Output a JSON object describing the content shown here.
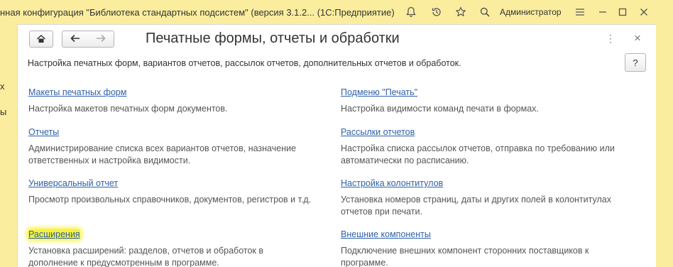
{
  "app": {
    "title": "нная конфигурация \"Библиотека стандартных подсистем\" (версия 3.1.2...   (1С:Предприятие)",
    "user": "Администратор"
  },
  "left_strip": {
    "fragments": [
      "х",
      "ы"
    ]
  },
  "page": {
    "title": "Печатные формы, отчеты и обработки",
    "subtitle": "Настройка печатных форм, вариантов отчетов, рассылок отчетов, дополнительных отчетов и обработок.",
    "help_label": "?",
    "more_label": "⋮",
    "close_label": "×"
  },
  "items_left": [
    {
      "label": "Макеты печатных форм",
      "desc": "Настройка макетов печатных форм документов."
    },
    {
      "label": "Отчеты",
      "desc": "Администрирование списка всех вариантов отчетов, назначение ответственных и настройка видимости."
    },
    {
      "label": "Универсальный отчет",
      "desc": "Просмотр произвольных справочников, документов, регистров и т.д."
    },
    {
      "label": "Расширения",
      "desc": "Установка расширений: разделов, отчетов и обработок в дополнение к предусмотренным в программе."
    }
  ],
  "items_right": [
    {
      "label": "Подменю \"Печать\"",
      "desc": "Настройка видимости команд печати в формах."
    },
    {
      "label": "Рассылки отчетов",
      "desc": "Настройка списка рассылок отчетов, отправка по требованию или автоматически по расписанию."
    },
    {
      "label": "Настройка колонтитулов",
      "desc": "Установка номеров страниц, даты и других полей в колонтитулах отчетов при печати."
    },
    {
      "label": "Внешние компоненты",
      "desc": "Подключение внешних компонент сторонних поставщиков к программе."
    }
  ],
  "colors": {
    "link": "#2f61a8",
    "frame": "#fbed9e",
    "highlight": "#f7f23b"
  }
}
